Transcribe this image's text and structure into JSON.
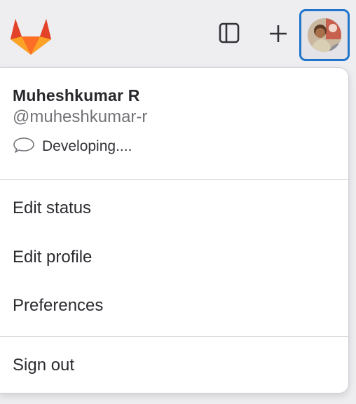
{
  "topbar": {
    "logo_icon": "gitlab-tanuki-icon",
    "sidebar_toggle_icon": "sidebar-panel-icon",
    "new_icon": "plus-icon",
    "avatar_icon": "user-avatar",
    "focus_color": "#1f75cb"
  },
  "user_menu": {
    "name": "Muheshkumar R",
    "username": "@muheshkumar-r",
    "status_icon": "speech-bubble-icon",
    "status_text": "Developing....",
    "items": [
      {
        "label": "Edit status"
      },
      {
        "label": "Edit profile"
      },
      {
        "label": "Preferences"
      }
    ],
    "sign_out_label": "Sign out"
  }
}
